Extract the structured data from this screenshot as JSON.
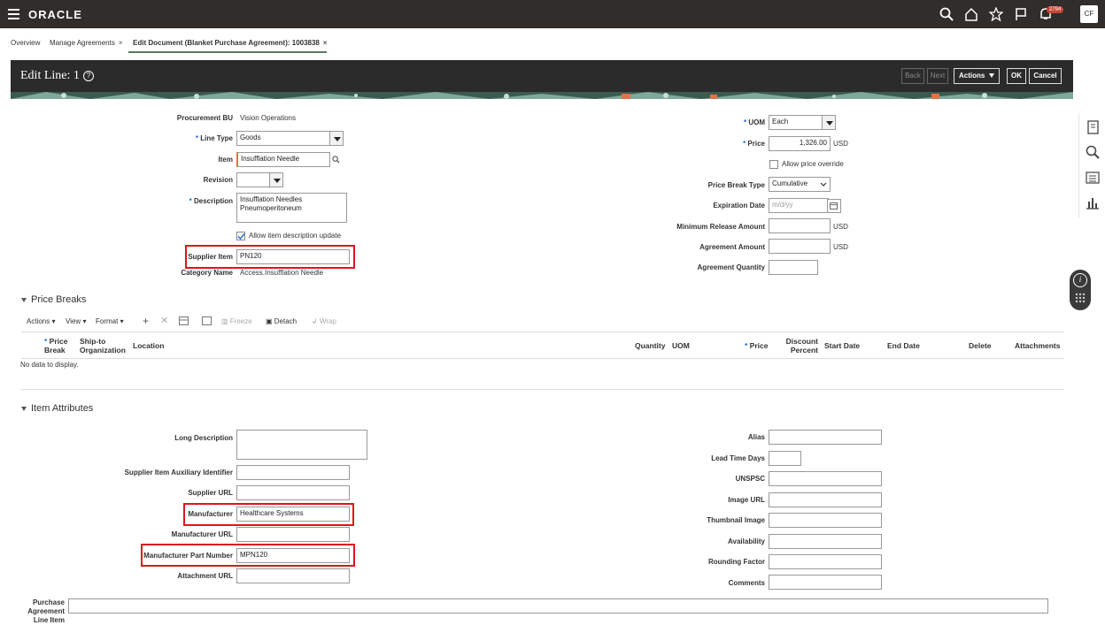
{
  "header": {
    "brand": "ORACLE",
    "notif_count": "2794",
    "user_initials": "CF"
  },
  "tabs": [
    {
      "label": "Overview"
    },
    {
      "label": "Manage Agreements"
    },
    {
      "label": "Edit Document (Blanket Purchase Agreement): 1003838"
    }
  ],
  "panel": {
    "title": "Edit Line: 1",
    "back": "Back",
    "next": "Next",
    "actions": "Actions",
    "ok": "OK",
    "cancel": "Cancel"
  },
  "line": {
    "procurement_bu_label": "Procurement BU",
    "procurement_bu": "Vision Operations",
    "line_type_label": "Line Type",
    "line_type": "Goods",
    "item_label": "Item",
    "item": "Insufflation Needle",
    "revision_label": "Revision",
    "revision": "",
    "description_label": "Description",
    "description": "Insufflation Needles Pneumoperitoneum",
    "allow_desc_label": "Allow item description update",
    "supplier_item_label": "Supplier Item",
    "supplier_item": "PN120",
    "category_label": "Category Name",
    "category": "Access.Insufflation Needle",
    "uom_label": "UOM",
    "uom": "Each",
    "price_label": "Price",
    "price": "1,326.00",
    "currency": "USD",
    "allow_price_override_label": "Allow price override",
    "price_break_type_label": "Price Break Type",
    "price_break_type": "Cumulative",
    "expiration_date_label": "Expiration Date",
    "expiration_date_placeholder": "m/d/yy",
    "min_release_label": "Minimum Release Amount",
    "agreement_amount_label": "Agreement Amount",
    "agreement_qty_label": "Agreement Quantity"
  },
  "price_breaks": {
    "title": "Price Breaks",
    "toolbar": {
      "actions": "Actions",
      "view": "View",
      "format": "Format",
      "freeze": "Freeze",
      "detach": "Detach",
      "wrap": "Wrap"
    },
    "columns": {
      "price_break": "Price Break",
      "ship_to": "Ship-to Organization",
      "location": "Location",
      "quantity": "Quantity",
      "uom": "UOM",
      "price": "Price",
      "discount": "Discount Percent",
      "start": "Start Date",
      "end": "End Date",
      "delete": "Delete",
      "attachments": "Attachments"
    },
    "empty": "No data to display."
  },
  "item_attributes": {
    "title": "Item Attributes",
    "long_description_label": "Long Description",
    "aux_id_label": "Supplier Item Auxiliary Identifier",
    "supplier_url_label": "Supplier URL",
    "manufacturer_label": "Manufacturer",
    "manufacturer": "Healthcare Systems",
    "manufacturer_url_label": "Manufacturer URL",
    "mpn_label": "Manufacturer Part Number",
    "mpn": "MPN120",
    "attachment_url_label": "Attachment URL",
    "alias_label": "Alias",
    "lead_time_label": "Lead Time Days",
    "unspsc_label": "UNSPSC",
    "image_url_label": "Image URL",
    "thumbnail_label": "Thumbnail Image",
    "availability_label": "Availability",
    "rounding_label": "Rounding Factor",
    "comments_label": "Comments",
    "pa_line_label": "Purchase Agreement Line Item"
  }
}
